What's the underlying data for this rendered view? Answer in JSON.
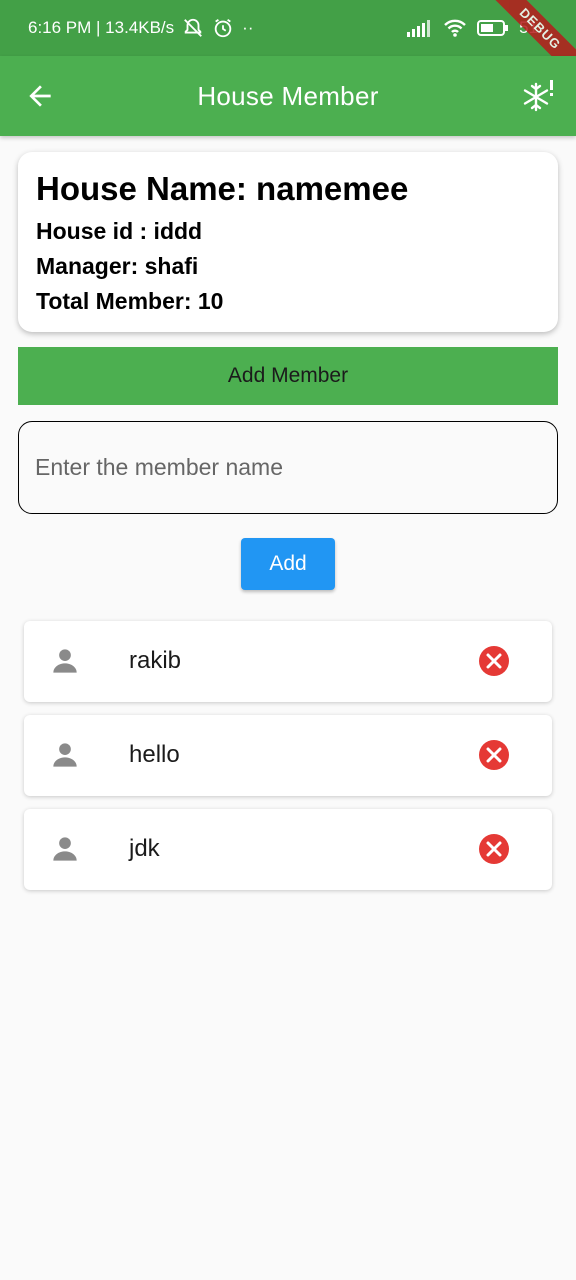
{
  "status_bar": {
    "time_speed": "6:16 PM | 13.4KB/s",
    "extra_dots": "··",
    "battery": "51"
  },
  "debug_banner": "DEBUG",
  "app_bar": {
    "title": "House Member"
  },
  "house": {
    "name": "House Name: namemee",
    "id": "House id : iddd",
    "manager": "Manager: shafi",
    "total": "Total Member: 10"
  },
  "add_member_bar": {
    "label": "Add Member"
  },
  "member_input": {
    "placeholder": "Enter the member name"
  },
  "add_button": {
    "label": "Add"
  },
  "members": [
    {
      "name": "rakib"
    },
    {
      "name": "hello"
    },
    {
      "name": "jdk"
    }
  ],
  "colors": {
    "status_bar": "#43a047",
    "app_bar": "#4caf50",
    "add_button": "#2196f3",
    "remove_icon": "#e53935",
    "person_icon": "#8a8a8a"
  }
}
